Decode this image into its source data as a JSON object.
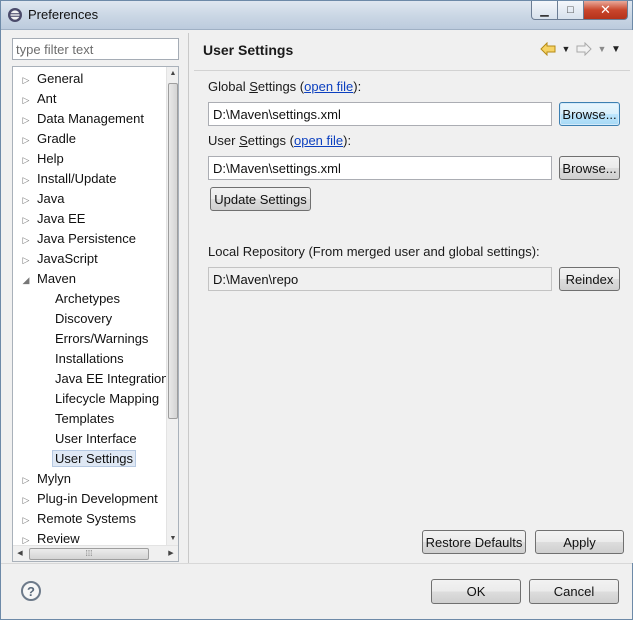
{
  "window": {
    "title": "Preferences",
    "minimize_glyph": "▁",
    "maximize_glyph": "□",
    "close_glyph": "✕"
  },
  "filter": {
    "placeholder": "type filter text",
    "value": ""
  },
  "tree": {
    "items": [
      {
        "label": "General",
        "level": 0,
        "expanded": false
      },
      {
        "label": "Ant",
        "level": 0,
        "expanded": false
      },
      {
        "label": "Data Management",
        "level": 0,
        "expanded": false
      },
      {
        "label": "Gradle",
        "level": 0,
        "expanded": false
      },
      {
        "label": "Help",
        "level": 0,
        "expanded": false
      },
      {
        "label": "Install/Update",
        "level": 0,
        "expanded": false
      },
      {
        "label": "Java",
        "level": 0,
        "expanded": false
      },
      {
        "label": "Java EE",
        "level": 0,
        "expanded": false
      },
      {
        "label": "Java Persistence",
        "level": 0,
        "expanded": false
      },
      {
        "label": "JavaScript",
        "level": 0,
        "expanded": false
      },
      {
        "label": "Maven",
        "level": 0,
        "expanded": true
      },
      {
        "label": "Archetypes",
        "level": 1
      },
      {
        "label": "Discovery",
        "level": 1
      },
      {
        "label": "Errors/Warnings",
        "level": 1
      },
      {
        "label": "Installations",
        "level": 1
      },
      {
        "label": "Java EE Integration",
        "level": 1
      },
      {
        "label": "Lifecycle Mapping",
        "level": 1
      },
      {
        "label": "Templates",
        "level": 1
      },
      {
        "label": "User Interface",
        "level": 1
      },
      {
        "label": "User Settings",
        "level": 1,
        "selected": true
      },
      {
        "label": "Mylyn",
        "level": 0,
        "expanded": false
      },
      {
        "label": "Plug-in Development",
        "level": 0,
        "expanded": false
      },
      {
        "label": "Remote Systems",
        "level": 0,
        "expanded": false
      },
      {
        "label": "Review",
        "level": 0,
        "expanded": false
      }
    ]
  },
  "page": {
    "title": "User Settings",
    "global": {
      "label_prefix": "Global ",
      "label_underlined": "S",
      "label_rest": "ettings (",
      "link": "open file",
      "label_suffix": "):",
      "value": "D:\\Maven\\settings.xml",
      "browse_label": "Browse..."
    },
    "user": {
      "label_prefix": "User ",
      "label_underlined": "S",
      "label_rest": "ettings (",
      "link": "open file",
      "label_suffix": "):",
      "value": "D:\\Maven\\settings.xml",
      "browse_label": "Browse..."
    },
    "update_label": "Update Settings",
    "local_repo": {
      "label": "Local Repository (From merged user and global settings):",
      "value": "D:\\Maven\\repo",
      "reindex_label": "Reindex"
    },
    "restore_label": "Restore Defaults",
    "apply_label": "Apply"
  },
  "footer": {
    "help_glyph": "?",
    "ok_label": "OK",
    "cancel_label": "Cancel"
  },
  "colors": {
    "link": "#0b3fbf",
    "selection": "#dfe8f4",
    "focus_border": "#3c7fb1"
  }
}
